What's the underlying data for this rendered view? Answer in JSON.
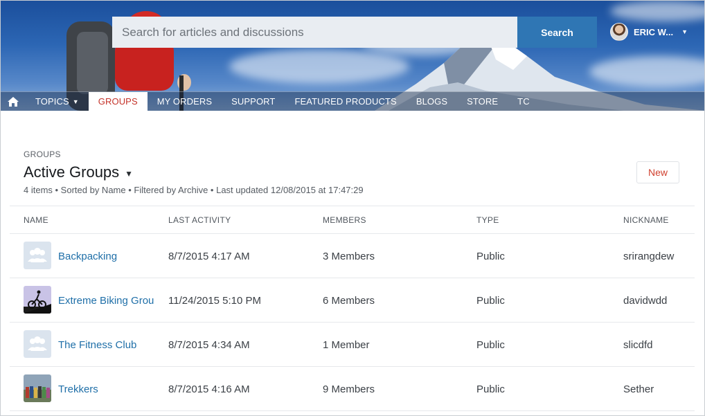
{
  "header": {
    "search_placeholder": "Search for articles and discussions",
    "search_button": "Search",
    "user_name": "ERIC W..."
  },
  "nav": {
    "items": [
      {
        "label": "TOPICS",
        "has_dropdown": true
      },
      {
        "label": "GROUPS",
        "active": true
      },
      {
        "label": "MY ORDERS"
      },
      {
        "label": "SUPPORT"
      },
      {
        "label": "FEATURED PRODUCTS"
      },
      {
        "label": "BLOGS"
      },
      {
        "label": "STORE"
      },
      {
        "label": "TC"
      }
    ]
  },
  "list": {
    "kicker": "GROUPS",
    "title": "Active Groups",
    "meta": "4 items • Sorted by Name • Filtered by Archive • Last updated 12/08/2015  at 17:47:29",
    "new_button": "New",
    "columns": [
      "NAME",
      "LAST ACTIVITY",
      "MEMBERS",
      "TYPE",
      "NICKNAME"
    ],
    "rows": [
      {
        "name": "Backpacking",
        "icon": "group-default-icon",
        "last_activity": "8/7/2015 4:17 AM",
        "members": "3 Members",
        "type": "Public",
        "nickname": "srirangdew"
      },
      {
        "name": "Extreme Biking Grou",
        "icon": "biker-thumbnail",
        "last_activity": "11/24/2015 5:10 PM",
        "members": "6 Members",
        "type": "Public",
        "nickname": "davidwdd"
      },
      {
        "name": "The Fitness Club",
        "icon": "group-default-icon",
        "last_activity": "8/7/2015 4:34 AM",
        "members": "1 Member",
        "type": "Public",
        "nickname": "slicdfd"
      },
      {
        "name": "Trekkers",
        "icon": "group-photo-thumbnail",
        "last_activity": "8/7/2015 4:16 AM",
        "members": "9 Members",
        "type": "Public",
        "nickname": "Sether"
      }
    ]
  },
  "colors": {
    "accent_red": "#c4332a",
    "link_blue": "#1f6fa8",
    "search_button_blue": "#2f76b4"
  }
}
